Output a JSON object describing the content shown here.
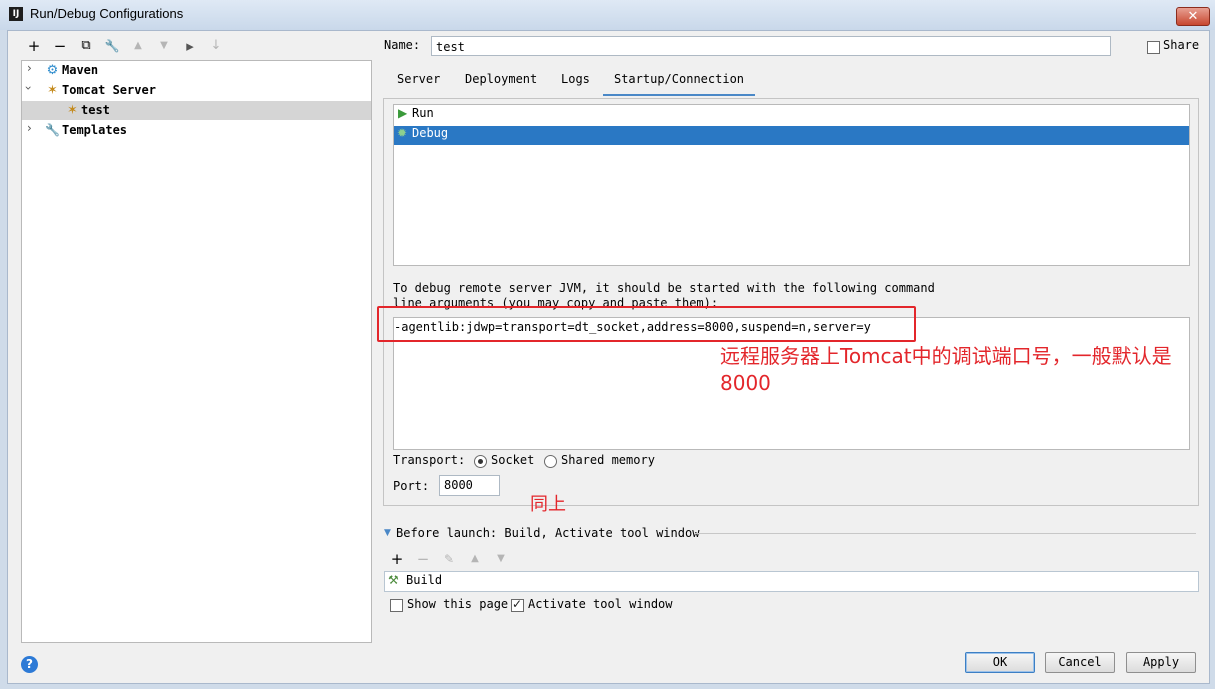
{
  "window": {
    "title": "Run/Debug Configurations",
    "app_icon": "IJ",
    "close_glyph": "✕"
  },
  "toolbar": {
    "add": "+",
    "remove": "−",
    "copy": "⧉",
    "edit_defaults": "🔧",
    "move_up": "▲",
    "move_down": "▼",
    "folder": "▸",
    "sort": "↓"
  },
  "tree": {
    "items": [
      {
        "label": "Maven",
        "icon": "gear-icon"
      },
      {
        "label": "Tomcat Server",
        "icon": "tomcat-icon"
      },
      {
        "label": "test",
        "icon": "tomcat-icon"
      },
      {
        "label": "Templates",
        "icon": "wrench-icon"
      }
    ]
  },
  "config": {
    "name_label": "Name:",
    "name_value": "test",
    "share_label": "Share"
  },
  "tabs": [
    "Server",
    "Deployment",
    "Logs",
    "Startup/Connection"
  ],
  "startup": {
    "items": [
      "Run",
      "Debug"
    ],
    "selected": "Debug",
    "description": "To debug remote server JVM, it should be started with the following command line arguments (you may copy and paste them):",
    "arguments": "-agentlib:jdwp=transport=dt_socket,address=8000,suspend=n,server=y",
    "transport_label": "Transport:",
    "transport_options": [
      "Socket",
      "Shared memory"
    ],
    "transport_selected": "Socket",
    "port_label": "Port:",
    "port_value": "8000"
  },
  "annotations": {
    "note_1": "远程服务器上Tomcat中的调试端口号，一般默认是8000",
    "note_2": "同上"
  },
  "before_launch": {
    "header": "Before launch: Build, Activate tool window",
    "items": [
      "Build"
    ],
    "show_this_page": "Show this page",
    "show_this_page_checked": false,
    "activate_tool_window": "Activate tool window",
    "activate_tool_window_checked": true
  },
  "buttons": {
    "ok": "OK",
    "cancel": "Cancel",
    "apply": "Apply",
    "help": "?"
  },
  "colors": {
    "selection": "#2a78c4",
    "annotation": "#e3262b",
    "tab_underline": "#4a88c7"
  }
}
